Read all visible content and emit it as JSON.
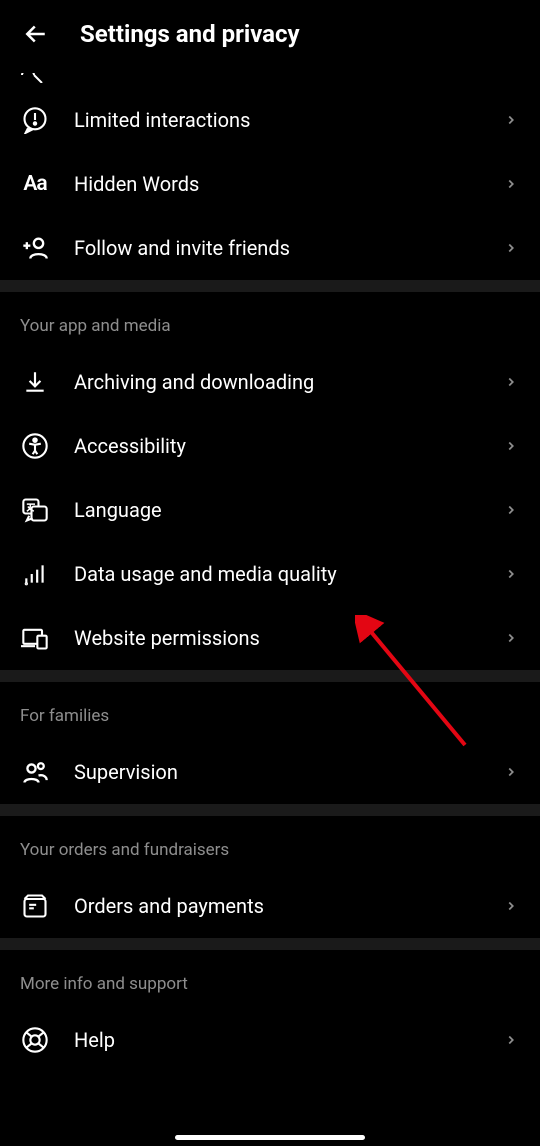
{
  "header": {
    "title": "Settings and privacy"
  },
  "top_items": [
    {
      "label": "Limited interactions",
      "icon": "alert-bubble-icon"
    },
    {
      "label": "Hidden Words",
      "icon": "aa-icon"
    },
    {
      "label": "Follow and invite friends",
      "icon": "add-person-icon"
    }
  ],
  "sections": [
    {
      "title": "Your app and media",
      "items": [
        {
          "label": "Archiving and downloading",
          "icon": "download-icon"
        },
        {
          "label": "Accessibility",
          "icon": "accessibility-icon"
        },
        {
          "label": "Language",
          "icon": "translate-icon"
        },
        {
          "label": "Data usage and media quality",
          "icon": "bars-icon"
        },
        {
          "label": "Website permissions",
          "icon": "devices-icon"
        }
      ]
    },
    {
      "title": "For families",
      "items": [
        {
          "label": "Supervision",
          "icon": "people-icon"
        }
      ]
    },
    {
      "title": "Your orders and fundraisers",
      "items": [
        {
          "label": "Orders and payments",
          "icon": "box-icon"
        }
      ]
    },
    {
      "title": "More info and support",
      "items": [
        {
          "label": "Help",
          "icon": "lifebuoy-icon"
        }
      ]
    }
  ]
}
